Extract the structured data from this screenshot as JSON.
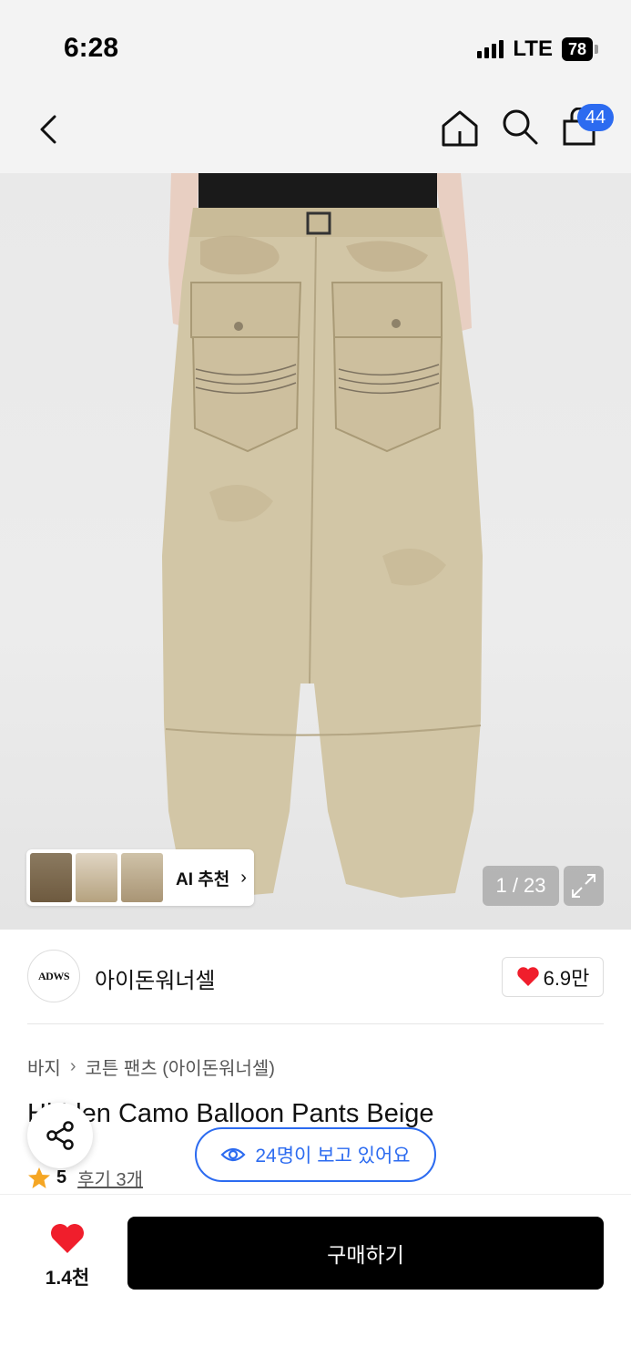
{
  "status_bar": {
    "time": "6:28",
    "network": "LTE",
    "battery": "78"
  },
  "nav": {
    "cart_badge": "44"
  },
  "gallery": {
    "ai_label": "AI 추천",
    "page_counter": "1 / 23"
  },
  "brand": {
    "logo_text": "ADWS",
    "name": "아이돈워너셀",
    "like_count": "6.9만"
  },
  "breadcrumb": {
    "level1": "바지",
    "level2": "코튼 팬츠 (아이돈워너셀)"
  },
  "product": {
    "title": "Hidden Camo Balloon Pants Beige"
  },
  "rating": {
    "score": "5",
    "review_label": "후기 3개"
  },
  "viewers": {
    "text": "24명이 보고 있어요"
  },
  "bottom": {
    "wish_count": "1.4천",
    "buy_label": "구매하기"
  },
  "colors": {
    "accent": "#2c6bf0",
    "heart": "#f01e2c",
    "star": "#f5a623",
    "buy_button": "#000000"
  }
}
